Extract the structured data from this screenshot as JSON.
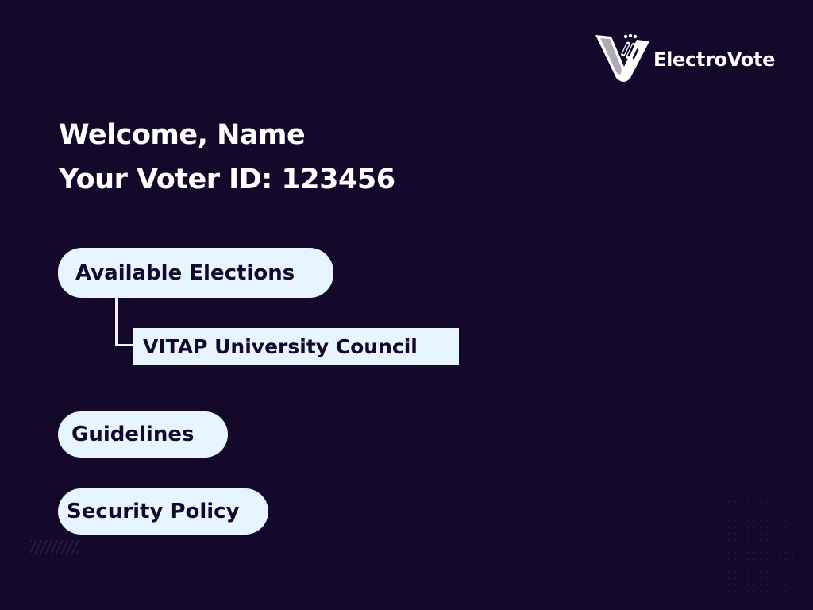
{
  "brand": {
    "name": "ElectroVote",
    "logo_icon": "ballot-hand-v-icon"
  },
  "welcome": {
    "line1": "Welcome, Name",
    "line2": "Your Voter ID: 123456"
  },
  "menu": {
    "available_elections": "Available Elections",
    "elections": [
      {
        "label": "VITAP University Council"
      }
    ],
    "guidelines": "Guidelines",
    "security_policy": "Security Policy"
  },
  "colors": {
    "background": "#14082b",
    "pill_background": "#e6f5ff",
    "pill_text": "#14082b",
    "heading_text": "#ffffff"
  }
}
